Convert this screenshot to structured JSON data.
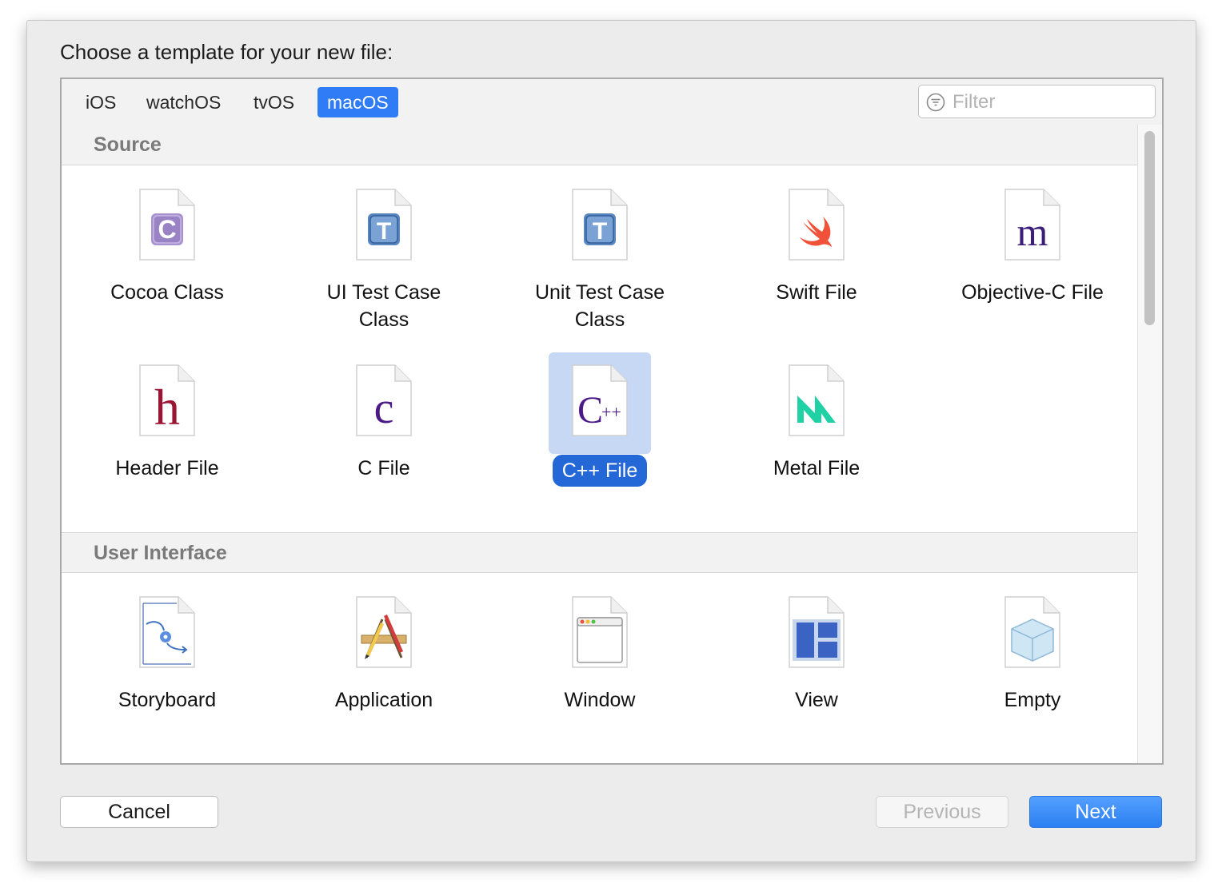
{
  "dialog": {
    "heading": "Choose a template for your new file:"
  },
  "platform_tabs": [
    {
      "label": "iOS",
      "selected": false
    },
    {
      "label": "watchOS",
      "selected": false
    },
    {
      "label": "tvOS",
      "selected": false
    },
    {
      "label": "macOS",
      "selected": true
    }
  ],
  "filter": {
    "placeholder": "Filter",
    "value": ""
  },
  "sections": [
    {
      "title": "Source",
      "items": [
        {
          "label": "Cocoa Class",
          "icon": "cocoa-class-icon"
        },
        {
          "label": "UI Test Case Class",
          "icon": "ui-test-case-icon"
        },
        {
          "label": "Unit Test Case Class",
          "icon": "unit-test-case-icon"
        },
        {
          "label": "Swift File",
          "icon": "swift-icon"
        },
        {
          "label": "Objective-C File",
          "icon": "objective-c-icon"
        },
        {
          "label": "Header File",
          "icon": "header-file-icon"
        },
        {
          "label": "C File",
          "icon": "c-file-icon"
        },
        {
          "label": "C++ File",
          "icon": "cpp-file-icon",
          "selected": true
        },
        {
          "label": "Metal File",
          "icon": "metal-icon"
        }
      ]
    },
    {
      "title": "User Interface",
      "items": [
        {
          "label": "Storyboard",
          "icon": "storyboard-icon"
        },
        {
          "label": "Application",
          "icon": "application-icon"
        },
        {
          "label": "Window",
          "icon": "window-icon"
        },
        {
          "label": "View",
          "icon": "view-icon"
        },
        {
          "label": "Empty",
          "icon": "empty-icon"
        }
      ]
    }
  ],
  "buttons": {
    "cancel": "Cancel",
    "previous": "Previous",
    "next": "Next",
    "previous_enabled": false
  },
  "colors": {
    "accent": "#2f7cf6",
    "selection_bg": "#c7d8f5",
    "selection_label": "#2467d6"
  }
}
